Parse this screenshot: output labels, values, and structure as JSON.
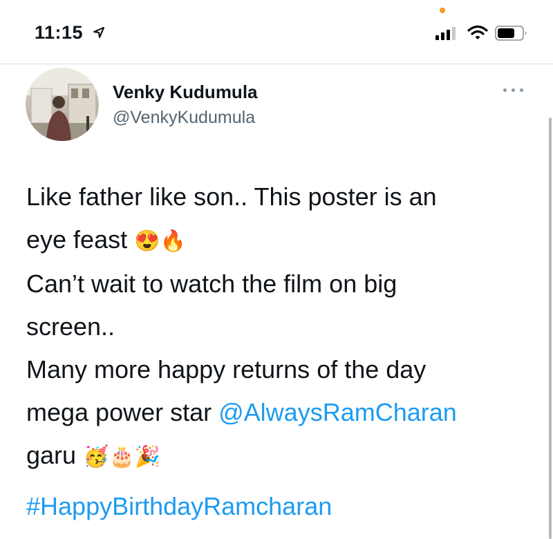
{
  "status_bar": {
    "time": "11:15",
    "location_icon": "location-arrow-icon",
    "signal_icon": "cellular-signal-icon",
    "wifi_icon": "wifi-icon",
    "battery_icon": "battery-icon",
    "recording_indicator_color": "#f59a23"
  },
  "tweet": {
    "author": {
      "display_name": "Venky Kudumula",
      "handle": "@VenkyKudumula"
    },
    "more_icon": "more-options-icon",
    "lines": {
      "l1": "Like father like son.. This poster is an",
      "l2": "eye feast",
      "l2_emoji_1": "😍",
      "l2_emoji_2": "🔥",
      "l3": "Can’t wait to watch the film on big",
      "l4": "screen..",
      "l5": "Many more happy returns of the day",
      "l6_prefix": "mega power star ",
      "mention": "@AlwaysRamCharan",
      "l7": "garu",
      "l7_emoji_1": "🥳",
      "l7_emoji_2": "🎂",
      "l7_emoji_3": "🎉"
    },
    "hashtag": "#HappyBirthdayRamcharan"
  },
  "colors": {
    "link": "#1d9bf0",
    "text": "#0f1419",
    "secondary": "#536471"
  }
}
